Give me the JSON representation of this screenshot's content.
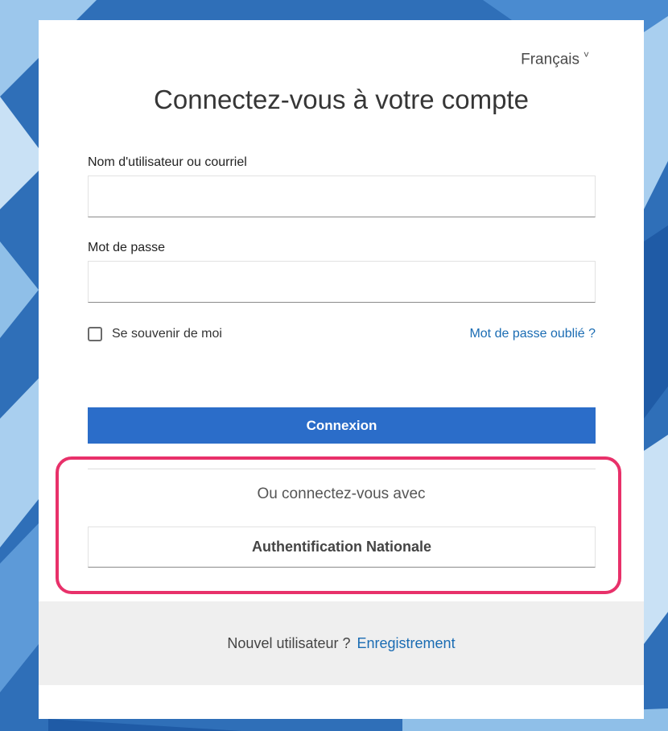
{
  "language": {
    "current": "Français",
    "chevron": "˅"
  },
  "title": "Connectez-vous à votre compte",
  "username": {
    "label": "Nom d'utilisateur ou courriel",
    "value": "",
    "placeholder": ""
  },
  "password": {
    "label": "Mot de passe",
    "value": "",
    "placeholder": ""
  },
  "remember_me": {
    "label": "Se souvenir de moi",
    "checked": false
  },
  "forgot_password": "Mot de passe oublié ?",
  "login_button": "Connexion",
  "alt_login": {
    "heading": "Ou connectez-vous avec",
    "providers": [
      "Authentification Nationale"
    ]
  },
  "footer": {
    "prompt": "Nouvel utilisateur ?",
    "register_link": "Enregistrement"
  },
  "colors": {
    "primary": "#2b6dc9",
    "link": "#1a6cb3",
    "highlight": "#e8316a",
    "footer_bg": "#efefef"
  }
}
